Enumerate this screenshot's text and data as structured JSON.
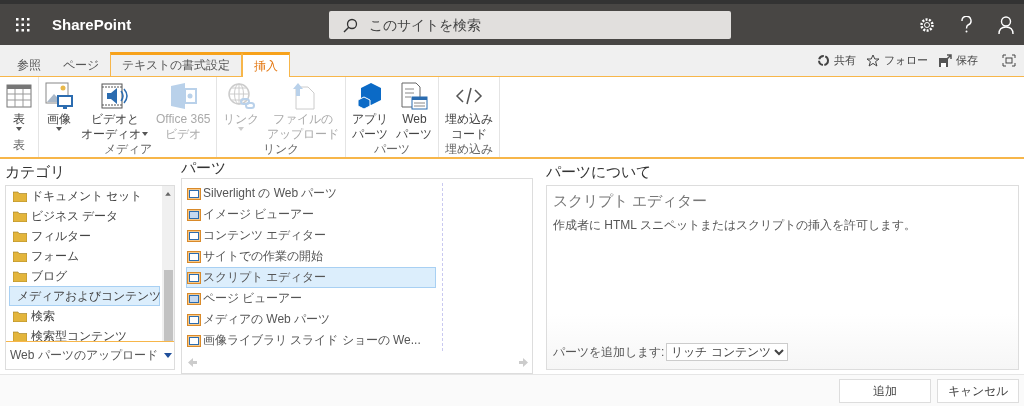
{
  "app_bar": {
    "title": "SharePoint",
    "search": {
      "placeholder": "このサイトを検索"
    }
  },
  "tabs": [
    {
      "label": "参照",
      "selected": false,
      "kind": "normal"
    },
    {
      "label": "ページ",
      "selected": false,
      "kind": "normal"
    },
    {
      "label": "テキストの書式設定",
      "selected": false,
      "kind": "contextual"
    },
    {
      "label": "挿入",
      "selected": true,
      "kind": "contextual"
    }
  ],
  "actions": [
    {
      "label": "共有",
      "kind": "share"
    },
    {
      "label": "フォロー",
      "kind": "follow"
    },
    {
      "label": "保存",
      "kind": "save"
    }
  ],
  "ribbon_groups": [
    {
      "label": "表",
      "buttons": [
        {
          "lines": [
            "表"
          ],
          "kind": "table",
          "disabled": false,
          "dropdown": true
        }
      ]
    },
    {
      "label": "メディア",
      "buttons": [
        {
          "lines": [
            "画像"
          ],
          "kind": "image",
          "disabled": false,
          "dropdown": true
        },
        {
          "lines": [
            "ビデオと",
            "オーディオ"
          ],
          "kind": "video",
          "disabled": false,
          "dropdown": true
        },
        {
          "lines": [
            "Office 365",
            "ビデオ"
          ],
          "kind": "office-video",
          "disabled": true,
          "dropdown": false
        }
      ]
    },
    {
      "label": "リンク",
      "buttons": [
        {
          "lines": [
            "リンク"
          ],
          "kind": "link",
          "disabled": true,
          "dropdown": true
        },
        {
          "lines": [
            "ファイルの",
            "アップロード"
          ],
          "kind": "upload",
          "disabled": true,
          "dropdown": false
        }
      ]
    },
    {
      "label": "パーツ",
      "buttons": [
        {
          "lines": [
            "アプリ",
            "パーツ"
          ],
          "kind": "app-part",
          "disabled": false,
          "dropdown": false
        },
        {
          "lines": [
            "Web",
            "パーツ"
          ],
          "kind": "web-part",
          "disabled": false,
          "dropdown": false
        }
      ]
    },
    {
      "label": "埋め込み",
      "buttons": [
        {
          "lines": [
            "埋め込み",
            "コード"
          ],
          "kind": "embed",
          "disabled": false,
          "dropdown": false
        }
      ]
    }
  ],
  "categories": {
    "heading": "カテゴリ",
    "items": [
      {
        "label": "ドキュメント セット",
        "selected": false
      },
      {
        "label": "ビジネス データ",
        "selected": false
      },
      {
        "label": "フィルター",
        "selected": false
      },
      {
        "label": "フォーム",
        "selected": false
      },
      {
        "label": "ブログ",
        "selected": false
      },
      {
        "label": "メディアおよびコンテンツ",
        "selected": true
      },
      {
        "label": "検索",
        "selected": false
      },
      {
        "label": "検索型コンテンツ",
        "selected": false
      }
    ],
    "upload_link": "Web パーツのアップロード"
  },
  "parts": {
    "heading": "パーツ",
    "items": [
      {
        "label": "Silverlight の Web パーツ",
        "selected": false
      },
      {
        "label": "イメージ ビューアー",
        "selected": false
      },
      {
        "label": "コンテンツ エディター",
        "selected": false
      },
      {
        "label": "サイトでの作業の開始",
        "selected": false
      },
      {
        "label": "スクリプト エディター",
        "selected": true
      },
      {
        "label": "ページ ビューアー",
        "selected": false
      },
      {
        "label": "メディアの Web パーツ",
        "selected": false
      },
      {
        "label": "画像ライブラリ スライド ショーの We...",
        "selected": false
      }
    ]
  },
  "about": {
    "heading": "パーツについて",
    "title": "スクリプト エディター",
    "description": "作成者に HTML スニペットまたはスクリプトの挿入を許可します。",
    "add_label": "パーツを追加します:",
    "zone": "リッチ コンテンツ"
  },
  "buttons": [
    "追加",
    "キャンセル"
  ]
}
